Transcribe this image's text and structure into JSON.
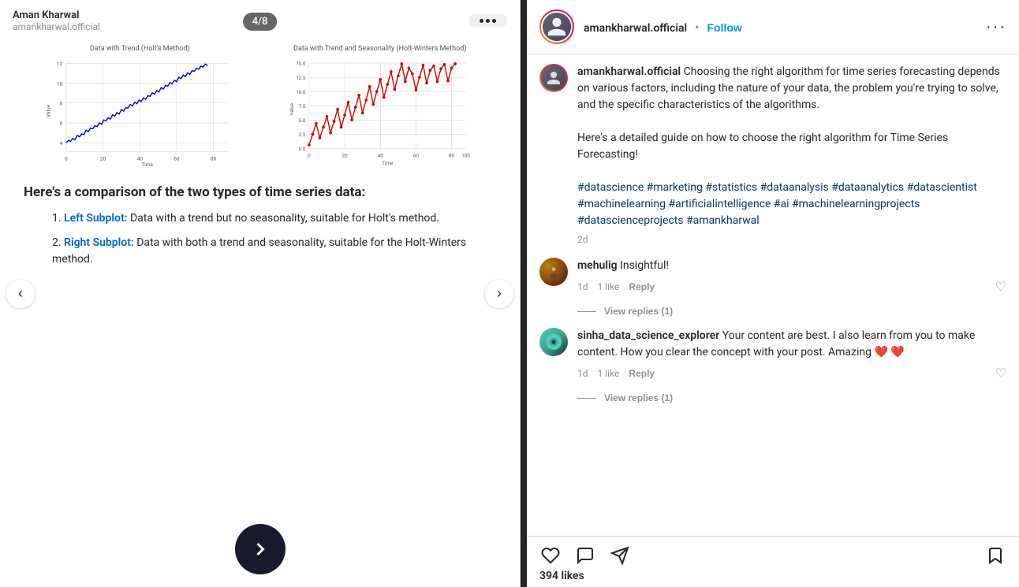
{
  "left": {
    "author_name": "Aman Kharwal",
    "author_handle": "amankharwal.official",
    "page_indicator": "4/8",
    "chart_left_title": "Data with Trend (Holt's Method)",
    "chart_right_title": "Data with Trend and Seasonality (Holt-Winters Method)",
    "main_heading": "Here's a comparison of the two types of time series data:",
    "list_items": [
      {
        "number": "1.",
        "highlight": "Left Subplot:",
        "text": " Data with a trend but no seasonality, suitable for Holt's method."
      },
      {
        "number": "2.",
        "highlight": "Right Subplot:",
        "text": " Data with both a trend and seasonality, suitable for the Holt-Winters method."
      }
    ]
  },
  "right": {
    "username": "amankharwal.official",
    "follow_label": "Follow",
    "caption": {
      "username": "amankharwal.official",
      "text": " Choosing the right algorithm for time series forecasting depends on various factors, including the nature of your data, the problem you're trying to solve, and the specific characteristics of the algorithms.\n\nHere's a detailed guide on how to choose the right algorithm for Time Series Forecasting!",
      "hashtags": "#datascience #marketing #statistics #dataanalysis #dataanalytics #datascientist #machinelearning #artificialintelligence #ai #machinelearningprojects #datascienceprojects #amankharwal",
      "time": "2d"
    },
    "comments": [
      {
        "username": "mehulig",
        "text": "Insightful!",
        "time": "1d",
        "likes": "1 like",
        "reply_label": "Reply",
        "view_replies": "View replies (1)",
        "avatar_type": "mehulig"
      },
      {
        "username": "sinha_data_science_explorer",
        "text": "Your content are best. I also learn from you to make content. How you clear the concept with your post. Amazing ❤️ ❤️",
        "time": "1d",
        "likes": "1 like",
        "reply_label": "Reply",
        "view_replies": "View replies (1)",
        "avatar_type": "sinha"
      }
    ],
    "likes_count": "394 likes",
    "icons": {
      "heart": "♡",
      "comment": "💬",
      "share": "✈",
      "bookmark": "🔖"
    }
  }
}
